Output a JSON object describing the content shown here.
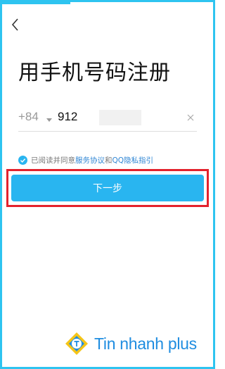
{
  "title": "用手机号码注册",
  "phone": {
    "country_code": "+84",
    "number_value": "912",
    "clear_icon": "close-icon"
  },
  "agreement": {
    "prefix": "已阅读并同意",
    "terms_link": "服务协议",
    "conjunction": "和",
    "privacy_link": "QQ隐私指引",
    "checked": true
  },
  "next_button_label": "下一步",
  "watermark": {
    "text": "Tin nhanh plus"
  },
  "colors": {
    "accent": "#29b5f0",
    "link": "#2f86d4",
    "highlight_border": "#e3222d",
    "frame": "#2ec4f0",
    "watermark": "#1f8de0"
  }
}
